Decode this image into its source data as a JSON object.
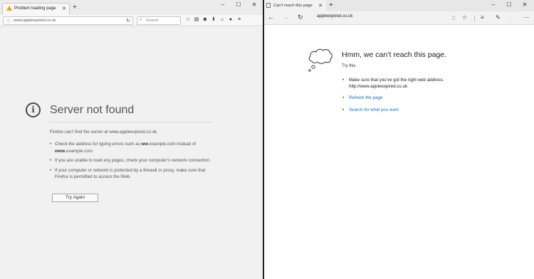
{
  "firefox": {
    "tab_title": "Problem loading page",
    "url": "www.appleexpired.co.uk",
    "search_placeholder": "Search",
    "error_title": "Server not found",
    "error_desc": "Firefox can’t find the server at www.appleexpired.co.uk.",
    "bullet1_a": "Check the address for typing errors such as ",
    "bullet1_b": "ww",
    "bullet1_c": ".example.com instead of ",
    "bullet1_d": "www",
    "bullet1_e": ".example.com",
    "bullet2": "If you are unable to load any pages, check your computer’s network connection.",
    "bullet3": "If your computer or network is protected by a firewall or proxy, make sure that Firefox is permitted to access the Web.",
    "try_again": "Try Again"
  },
  "edge": {
    "tab_title": "Can’t reach this page",
    "url": "appleexpired.co.uk",
    "heading": "Hmm, we can’t reach this page.",
    "try_this": "Try this",
    "item1_line1": "Make sure that you’ve got the right web address:",
    "item1_line2": "http://www.appleexpired.co.uk",
    "refresh_link": "Refresh the page",
    "search_link": "Search for what you want"
  },
  "icons": {
    "firefox_warning": "warning-triangle-icon",
    "edge_cloud": "thought-cloud-icon"
  },
  "colors": {
    "edge_link": "#1a6fc0",
    "firefox_warning": "#e8a317"
  }
}
